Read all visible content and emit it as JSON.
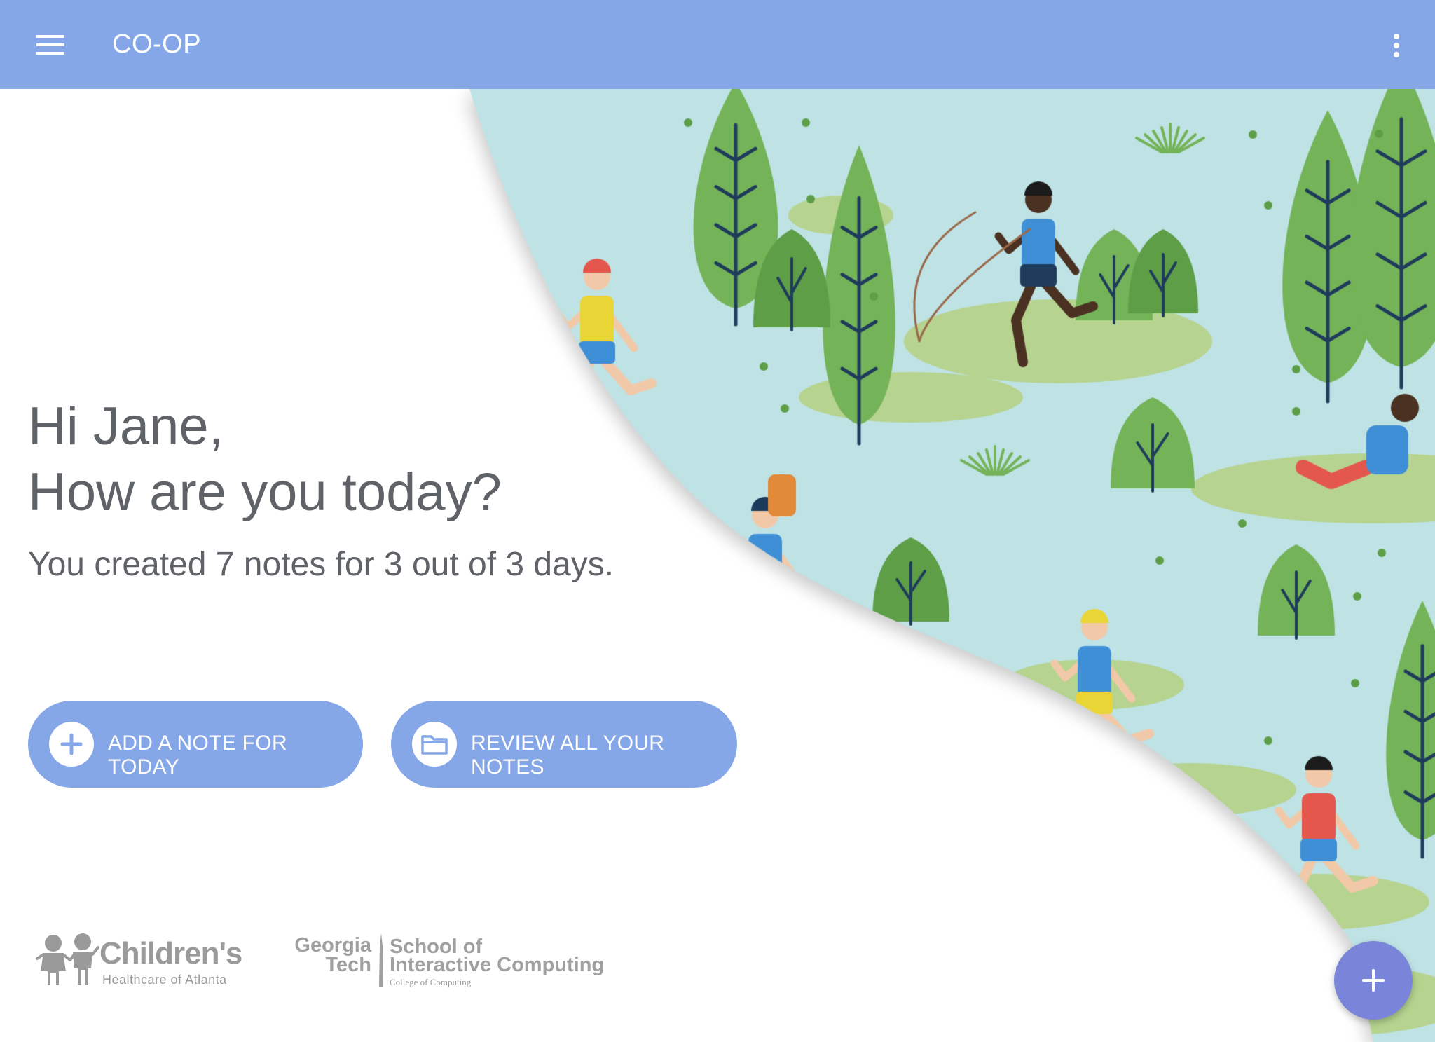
{
  "app": {
    "title": "CO-OP"
  },
  "greeting": {
    "line1": "Hi Jane,",
    "line2": "How are you today?"
  },
  "summary": "You created 7 notes for 3 out of 3 days.",
  "actions": {
    "add_note": "ADD A NOTE FOR TODAY",
    "review_notes": "REVIEW ALL YOUR NOTES"
  },
  "logos": {
    "childrens_name": "Children's",
    "childrens_sub": "Healthcare of Atlanta",
    "gt_line1": "Georgia",
    "gt_line2": "Tech",
    "gt_school1": "School of",
    "gt_school2": "Interactive Computing",
    "gt_college": "College of Computing"
  },
  "colors": {
    "appbar": "#85a7e8",
    "fab": "#7a84d8",
    "text": "#5f6368",
    "sky": "#bfe3e5"
  }
}
